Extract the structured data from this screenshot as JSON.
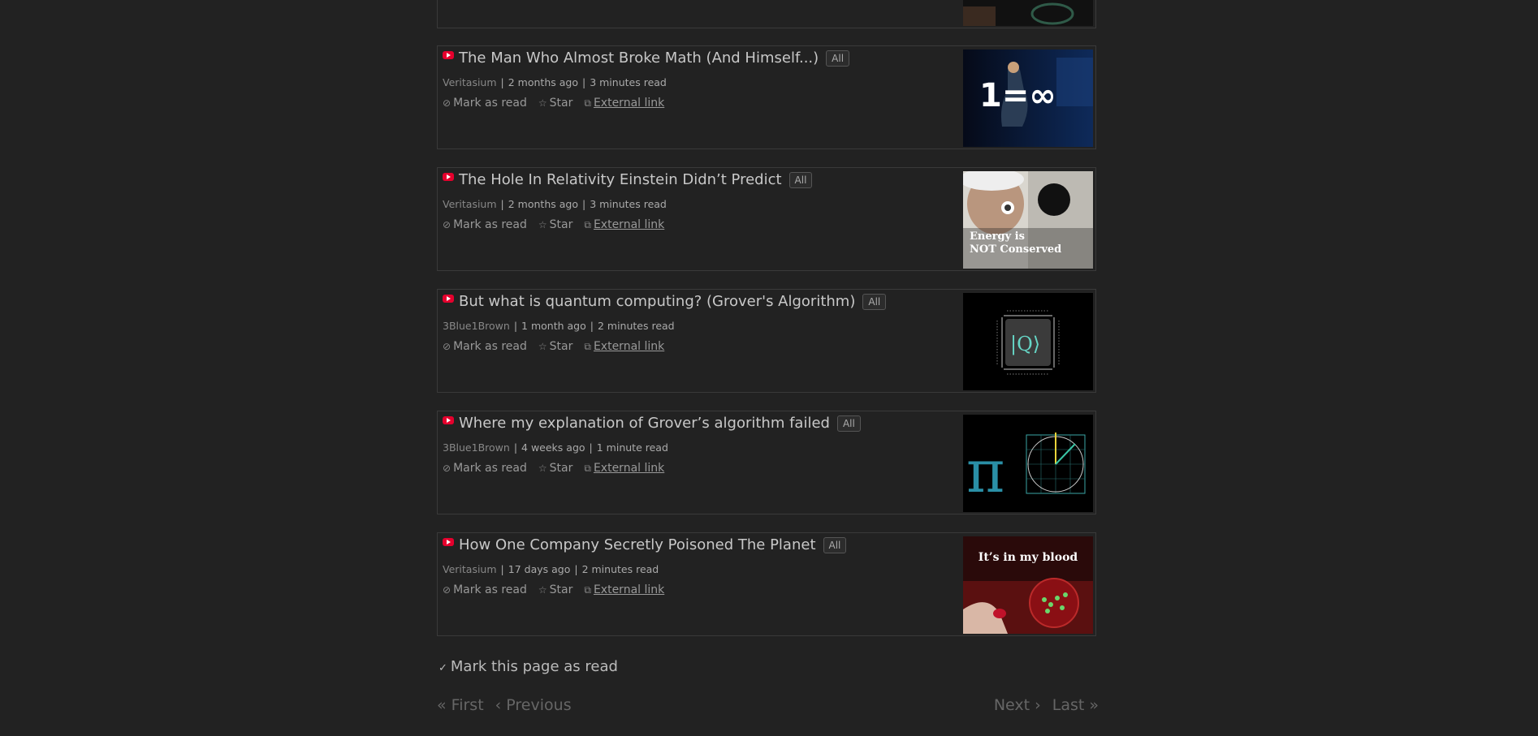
{
  "entries": [
    {
      "title": "The Man Who Almost Broke Math (And Himself...)",
      "category": "All",
      "feed": "Veritasium",
      "published": "2 months ago",
      "reading_time": "3 minutes read",
      "thumbnail_text": "1=∞"
    },
    {
      "title": "The Hole In Relativity Einstein Didn’t Predict",
      "category": "All",
      "feed": "Veritasium",
      "published": "2 months ago",
      "reading_time": "3 minutes read",
      "thumbnail_text_1": "Energy is",
      "thumbnail_text_2": "NOT Conserved"
    },
    {
      "title": "But what is quantum computing? (Grover's Algorithm)",
      "category": "All",
      "feed": "3Blue1Brown",
      "published": "1 month ago",
      "reading_time": "2 minutes read",
      "thumbnail_text": "|Q⟩"
    },
    {
      "title": "Where my explanation of Grover’s algorithm failed",
      "category": "All",
      "feed": "3Blue1Brown",
      "published": "4 weeks ago",
      "reading_time": "1 minute read",
      "thumbnail_text": "π"
    },
    {
      "title": "How One Company Secretly Poisoned The Planet",
      "category": "All",
      "feed": "Veritasium",
      "published": "17 days ago",
      "reading_time": "2 minutes read",
      "thumbnail_text": "It’s in my blood"
    }
  ],
  "actions": {
    "mark_as_read": "Mark as read",
    "star": "Star",
    "external_link": "External link"
  },
  "mark_page_as_read": "Mark this page as read",
  "pagination": {
    "first": "« First",
    "previous": "‹ Previous",
    "next": "Next ›",
    "last": "Last »"
  },
  "icons": {
    "feed_icon": "youtube-icon",
    "mark_read_icon": "check-circle-icon",
    "star_icon": "star-icon",
    "external_icon": "external-link-icon",
    "mark_page_icon": "check-icon"
  },
  "colors": {
    "background": "#222222",
    "youtube_red": "#e5002d"
  }
}
